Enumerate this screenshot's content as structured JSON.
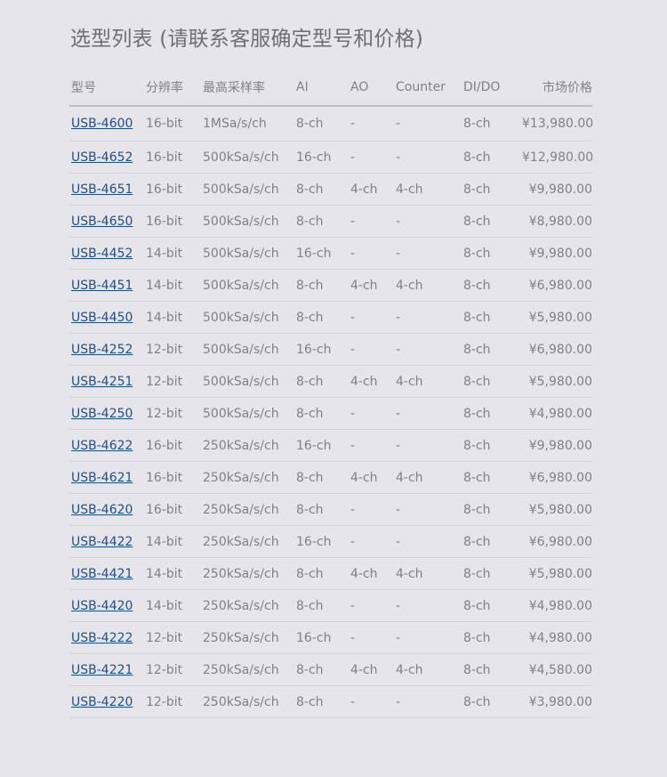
{
  "title": "选型列表 (请联系客服确定型号和价格)",
  "columns": [
    "型号",
    "分辨率",
    "最高采样率",
    "AI",
    "AO",
    "Counter",
    "DI/DO",
    "市场价格"
  ],
  "rows": [
    [
      "USB-4600",
      "16-bit",
      "1MSa/s/ch",
      "8-ch",
      "-",
      "-",
      "8-ch",
      "¥13,980.00"
    ],
    [
      "USB-4652",
      "16-bit",
      "500kSa/s/ch",
      "16-ch",
      "-",
      "-",
      "8-ch",
      "¥12,980.00"
    ],
    [
      "USB-4651",
      "16-bit",
      "500kSa/s/ch",
      "8-ch",
      "4-ch",
      "4-ch",
      "8-ch",
      "¥9,980.00"
    ],
    [
      "USB-4650",
      "16-bit",
      "500kSa/s/ch",
      "8-ch",
      "-",
      "-",
      "8-ch",
      "¥8,980.00"
    ],
    [
      "USB-4452",
      "14-bit",
      "500kSa/s/ch",
      "16-ch",
      "-",
      "-",
      "8-ch",
      "¥9,980.00"
    ],
    [
      "USB-4451",
      "14-bit",
      "500kSa/s/ch",
      "8-ch",
      "4-ch",
      "4-ch",
      "8-ch",
      "¥6,980.00"
    ],
    [
      "USB-4450",
      "14-bit",
      "500kSa/s/ch",
      "8-ch",
      "-",
      "-",
      "8-ch",
      "¥5,980.00"
    ],
    [
      "USB-4252",
      "12-bit",
      "500kSa/s/ch",
      "16-ch",
      "-",
      "-",
      "8-ch",
      "¥6,980.00"
    ],
    [
      "USB-4251",
      "12-bit",
      "500kSa/s/ch",
      "8-ch",
      "4-ch",
      "4-ch",
      "8-ch",
      "¥5,980.00"
    ],
    [
      "USB-4250",
      "12-bit",
      "500kSa/s/ch",
      "8-ch",
      "-",
      "-",
      "8-ch",
      "¥4,980.00"
    ],
    [
      "USB-4622",
      "16-bit",
      "250kSa/s/ch",
      "16-ch",
      "-",
      "-",
      "8-ch",
      "¥9,980.00"
    ],
    [
      "USB-4621",
      "16-bit",
      "250kSa/s/ch",
      "8-ch",
      "4-ch",
      "4-ch",
      "8-ch",
      "¥6,980.00"
    ],
    [
      "USB-4620",
      "16-bit",
      "250kSa/s/ch",
      "8-ch",
      "-",
      "-",
      "8-ch",
      "¥5,980.00"
    ],
    [
      "USB-4422",
      "14-bit",
      "250kSa/s/ch",
      "16-ch",
      "-",
      "-",
      "8-ch",
      "¥6,980.00"
    ],
    [
      "USB-4421",
      "14-bit",
      "250kSa/s/ch",
      "8-ch",
      "4-ch",
      "4-ch",
      "8-ch",
      "¥5,980.00"
    ],
    [
      "USB-4420",
      "14-bit",
      "250kSa/s/ch",
      "8-ch",
      "-",
      "-",
      "8-ch",
      "¥4,980.00"
    ],
    [
      "USB-4222",
      "12-bit",
      "250kSa/s/ch",
      "16-ch",
      "-",
      "-",
      "8-ch",
      "¥4,980.00"
    ],
    [
      "USB-4221",
      "12-bit",
      "250kSa/s/ch",
      "8-ch",
      "4-ch",
      "4-ch",
      "8-ch",
      "¥4,580.00"
    ],
    [
      "USB-4220",
      "12-bit",
      "250kSa/s/ch",
      "8-ch",
      "-",
      "-",
      "8-ch",
      "¥3,980.00"
    ]
  ]
}
